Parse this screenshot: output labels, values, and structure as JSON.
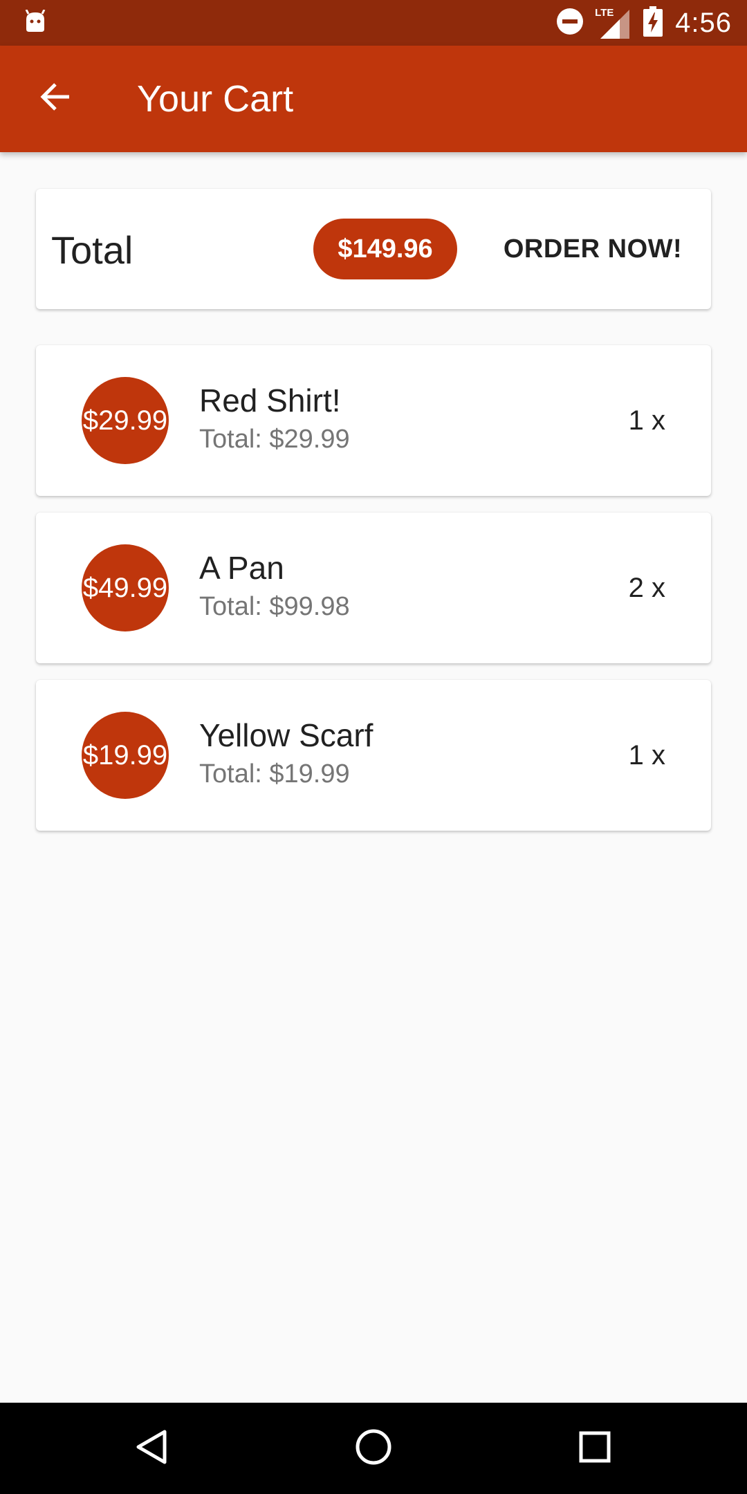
{
  "status_bar": {
    "time": "4:56",
    "network": "LTE",
    "icons": [
      "android-icon",
      "do-not-disturb-icon",
      "signal-icon",
      "battery-charging-icon"
    ]
  },
  "app_bar": {
    "title": "Your Cart",
    "back_icon": "arrow-back-icon"
  },
  "summary": {
    "label": "Total",
    "amount": "$149.96",
    "order_label": "ORDER NOW!"
  },
  "items": [
    {
      "price": "$29.99",
      "name": "Red Shirt!",
      "total": "Total: $29.99",
      "qty": "1 x"
    },
    {
      "price": "$49.99",
      "name": "A Pan",
      "total": "Total: $99.98",
      "qty": "2 x"
    },
    {
      "price": "$19.99",
      "name": "Yellow Scarf",
      "total": "Total: $19.99",
      "qty": "1 x"
    }
  ],
  "nav_bar": {
    "icons": [
      "back-triangle-icon",
      "home-circle-icon",
      "recents-square-icon"
    ]
  },
  "colors": {
    "primary": "#bf360c",
    "primary_dark": "#8f2a0b",
    "background": "#fafafa",
    "text_primary": "#212121",
    "text_secondary": "#757575"
  }
}
